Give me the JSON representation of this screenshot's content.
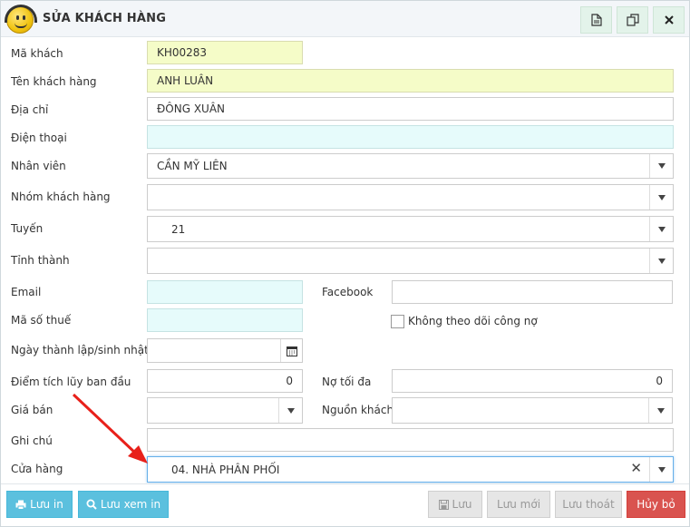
{
  "dialog": {
    "title": "SỬA KHÁCH HÀNG"
  },
  "form": {
    "ma_khach": {
      "label": "Mã khách",
      "value": "KH00283"
    },
    "ten_khach_hang": {
      "label": "Tên khách hàng",
      "value": "ANH LUÂN"
    },
    "dia_chi": {
      "label": "Địa chỉ",
      "value": "ĐÔNG XUÂN"
    },
    "dien_thoai": {
      "label": "Điện thoại",
      "value": ""
    },
    "nhan_vien": {
      "label": "Nhân viên",
      "value": "CẦN MỸ LIÊN"
    },
    "nhom_khach_hang": {
      "label": "Nhóm khách hàng",
      "value": ""
    },
    "tuyen": {
      "label": "Tuyến",
      "value": "21"
    },
    "tinh_thanh": {
      "label": "Tỉnh thành",
      "value": ""
    },
    "email": {
      "label": "Email",
      "value": ""
    },
    "facebook": {
      "label": "Facebook",
      "value": ""
    },
    "ma_so_thue": {
      "label": "Mã số thuế",
      "value": ""
    },
    "khong_theo_doi": {
      "label": "Không theo dõi công nợ",
      "checked": false
    },
    "ngay_thanh_lap": {
      "label": "Ngày thành lập/sinh nhật",
      "value": ""
    },
    "diem_tich_luy": {
      "label": "Điểm tích lũy ban đầu",
      "value": "0"
    },
    "no_toi_da": {
      "label": "Nợ tối đa",
      "value": "0"
    },
    "gia_ban": {
      "label": "Giá bán",
      "value": ""
    },
    "nguon_khach": {
      "label": "Nguồn khách",
      "value": ""
    },
    "ghi_chu": {
      "label": "Ghi chú",
      "value": ""
    },
    "cua_hang": {
      "label": "Cửa hàng",
      "value": "04. NHÀ PHÂN PHỐI"
    }
  },
  "footer": {
    "luu_in": "Lưu in",
    "luu_xem_in": "Lưu xem in",
    "luu": "Lưu",
    "luu_moi": "Lưu mới",
    "luu_thoat": "Lưu thoát",
    "huy_bo": "Hủy bỏ"
  },
  "colors": {
    "info": "#5bc0de",
    "danger": "#d9534f",
    "yellow_field": "#f5fcc8",
    "cyan_field": "#e6fbfb",
    "annotation_arrow": "#e8201a"
  },
  "icons": {
    "header_actions": [
      "document-icon",
      "copy-icon",
      "close-icon"
    ],
    "select": "chevron-down-icon",
    "calendar": "calendar-icon",
    "print": "print-icon",
    "search": "search-icon",
    "save": "save-icon"
  }
}
